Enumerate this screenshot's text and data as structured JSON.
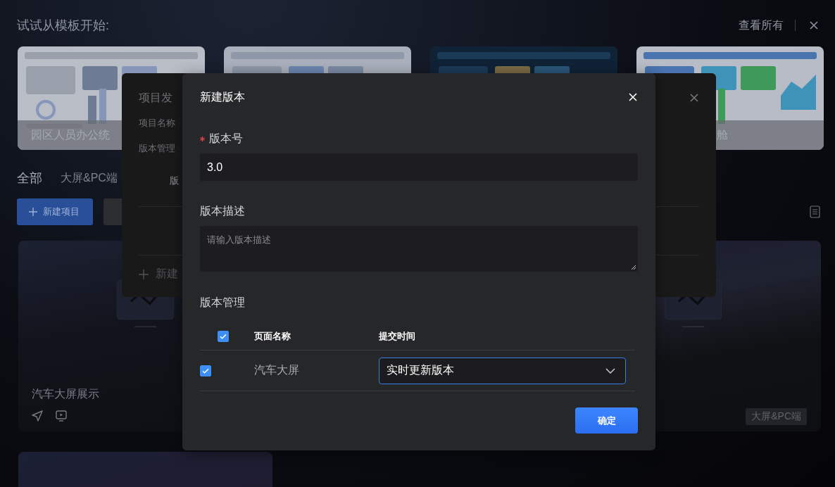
{
  "header": {
    "title": "试试从模板开始:",
    "view_all": "查看所有"
  },
  "templates": [
    {
      "kind": "picture",
      "caption": "园区人员办公统"
    },
    {
      "kind": "picture"
    },
    {
      "kind": "picture"
    },
    {
      "kind": "picture",
      "caption": "舱"
    }
  ],
  "tabs": [
    {
      "label": "全部",
      "selected": true
    },
    {
      "label": "大屏&PC端",
      "selected": false
    }
  ],
  "toolbar": {
    "new_button": "新建项目"
  },
  "projects": [
    {
      "kind": "card",
      "title": "汽车大屏展示"
    },
    {
      "kind": "card",
      "tag": "大屏&PC端"
    },
    {
      "kind": "card"
    }
  ],
  "publish_dialog": {
    "title": "项目发",
    "name_label": "项目名称",
    "section": "版本管理",
    "column": "版",
    "add": "新建"
  },
  "version_dialog": {
    "title": "新建版本",
    "version": {
      "label": "版本号",
      "required": true,
      "value": "3.0"
    },
    "description": {
      "label": "版本描述",
      "placeholder": "请输入版本描述"
    },
    "management": {
      "label": "版本管理",
      "all_checked": true,
      "columns": [
        {
          "label": "页面名称"
        },
        {
          "label": "提交时间"
        }
      ],
      "rows": [
        {
          "name": "汽车大屏",
          "checked": true,
          "time": "实时更新版本",
          "focused": true
        }
      ]
    },
    "confirm": "确定"
  }
}
